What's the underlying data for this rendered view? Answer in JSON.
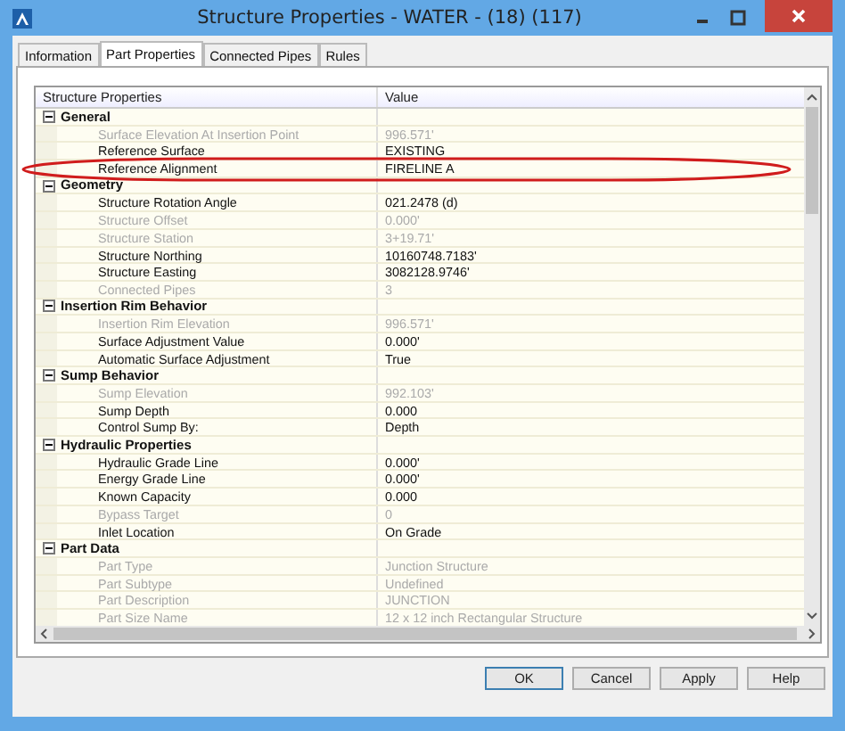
{
  "window": {
    "title": "Structure Properties - WATER - (18) (117)"
  },
  "tabs": [
    {
      "label": "Information",
      "selected": false
    },
    {
      "label": "Part Properties",
      "selected": true
    },
    {
      "label": "Connected Pipes",
      "selected": false
    },
    {
      "label": "Rules",
      "selected": false
    }
  ],
  "grid": {
    "columns": [
      "Structure Properties",
      "Value"
    ],
    "groups": [
      {
        "name": "General",
        "expanded": true,
        "rows": [
          {
            "label": "Surface Elevation At Insertion Point",
            "value": "996.571'",
            "disabled": true
          },
          {
            "label": "Reference Surface",
            "value": "EXISTING",
            "disabled": false
          },
          {
            "label": "Reference Alignment",
            "value": "FIRELINE A",
            "disabled": false
          }
        ]
      },
      {
        "name": "Geometry",
        "expanded": true,
        "rows": [
          {
            "label": "Structure Rotation Angle",
            "value": "021.2478 (d)",
            "disabled": false
          },
          {
            "label": "Structure Offset",
            "value": "0.000'",
            "disabled": true
          },
          {
            "label": "Structure Station",
            "value": "3+19.71'",
            "disabled": true
          },
          {
            "label": "Structure Northing",
            "value": "10160748.7183'",
            "disabled": false
          },
          {
            "label": "Structure Easting",
            "value": "3082128.9746'",
            "disabled": false
          },
          {
            "label": "Connected Pipes",
            "value": "3",
            "disabled": true
          }
        ]
      },
      {
        "name": "Insertion Rim Behavior",
        "expanded": true,
        "rows": [
          {
            "label": "Insertion Rim Elevation",
            "value": "996.571'",
            "disabled": true
          },
          {
            "label": "Surface Adjustment Value",
            "value": "0.000'",
            "disabled": false
          },
          {
            "label": "Automatic Surface Adjustment",
            "value": "True",
            "disabled": false
          }
        ]
      },
      {
        "name": "Sump Behavior",
        "expanded": true,
        "rows": [
          {
            "label": "Sump Elevation",
            "value": "992.103'",
            "disabled": true
          },
          {
            "label": "Sump Depth",
            "value": "0.000",
            "disabled": false
          },
          {
            "label": "Control Sump By:",
            "value": "Depth",
            "disabled": false
          }
        ]
      },
      {
        "name": "Hydraulic Properties",
        "expanded": true,
        "rows": [
          {
            "label": "Hydraulic Grade Line",
            "value": "0.000'",
            "disabled": false
          },
          {
            "label": "Energy Grade Line",
            "value": "0.000'",
            "disabled": false
          },
          {
            "label": "Known Capacity",
            "value": "0.000",
            "disabled": false
          },
          {
            "label": "Bypass Target",
            "value": "0",
            "disabled": true
          },
          {
            "label": "Inlet Location",
            "value": "On Grade",
            "disabled": false
          }
        ]
      },
      {
        "name": "Part Data",
        "expanded": true,
        "rows": [
          {
            "label": "Part Type",
            "value": "Junction Structure",
            "disabled": true
          },
          {
            "label": "Part Subtype",
            "value": "Undefined",
            "disabled": true
          },
          {
            "label": "Part Description",
            "value": "JUNCTION",
            "disabled": true
          },
          {
            "label": "Part Size Name",
            "value": "12 x 12 inch Rectangular Structure",
            "disabled": true
          }
        ]
      }
    ]
  },
  "buttons": [
    "OK",
    "Cancel",
    "Apply",
    "Help"
  ]
}
